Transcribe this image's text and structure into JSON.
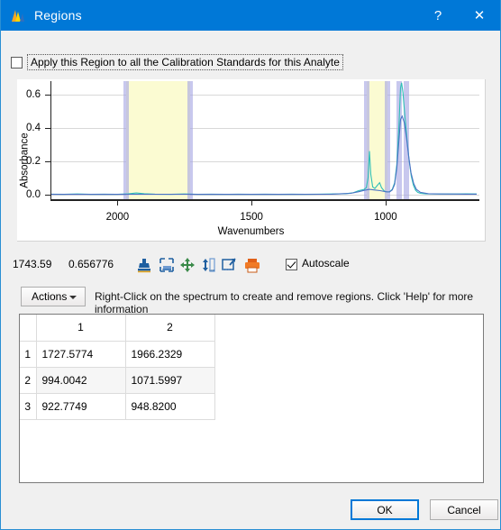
{
  "window": {
    "title": "Regions",
    "icon": "spectrum-peak-icon",
    "help_label": "?",
    "close_label": "✕",
    "accent_color": "#0078d7"
  },
  "apply_region": {
    "label": "Apply this Region to all the Calibration Standards for this Analyte",
    "checked": false
  },
  "chart_data": {
    "type": "line",
    "title": "",
    "xlabel": "Wavenumbers",
    "ylabel": "Absorbance",
    "xlim": [
      2250,
      650
    ],
    "ylim": [
      -0.04,
      0.68
    ],
    "x_ticks": [
      2000,
      1500,
      1000
    ],
    "y_ticks": [
      "0.0",
      "0.2",
      "0.4",
      "0.6"
    ],
    "grid": true,
    "legend": "none",
    "series": [
      {
        "name": "spectrum-teal",
        "color": "#2fbfb8",
        "points": [
          [
            2250,
            0.001
          ],
          [
            2200,
            0.0
          ],
          [
            2150,
            0.002
          ],
          [
            2100,
            0.0
          ],
          [
            2050,
            0.001
          ],
          [
            2000,
            0.0
          ],
          [
            1960,
            0.003
          ],
          [
            1930,
            0.008
          ],
          [
            1900,
            0.004
          ],
          [
            1860,
            0.001
          ],
          [
            1800,
            0.0
          ],
          [
            1750,
            0.002
          ],
          [
            1700,
            0.0
          ],
          [
            1650,
            0.001
          ],
          [
            1600,
            0.0
          ],
          [
            1550,
            0.001
          ],
          [
            1500,
            0.0
          ],
          [
            1450,
            0.001
          ],
          [
            1400,
            0.0
          ],
          [
            1350,
            0.001
          ],
          [
            1300,
            0.0
          ],
          [
            1250,
            0.001
          ],
          [
            1200,
            0.002
          ],
          [
            1150,
            0.004
          ],
          [
            1120,
            0.01
          ],
          [
            1100,
            0.022
          ],
          [
            1080,
            0.03
          ],
          [
            1072,
            0.04
          ],
          [
            1065,
            0.1
          ],
          [
            1060,
            0.26
          ],
          [
            1055,
            0.12
          ],
          [
            1048,
            0.045
          ],
          [
            1040,
            0.035
          ],
          [
            1030,
            0.055
          ],
          [
            1022,
            0.07
          ],
          [
            1015,
            0.04
          ],
          [
            1005,
            0.02
          ],
          [
            995,
            0.014
          ],
          [
            985,
            0.016
          ],
          [
            975,
            0.03
          ],
          [
            966,
            0.07
          ],
          [
            958,
            0.18
          ],
          [
            950,
            0.42
          ],
          [
            944,
            0.64
          ],
          [
            940,
            0.67
          ],
          [
            935,
            0.61
          ],
          [
            928,
            0.47
          ],
          [
            920,
            0.33
          ],
          [
            912,
            0.2
          ],
          [
            904,
            0.11
          ],
          [
            896,
            0.055
          ],
          [
            888,
            0.025
          ],
          [
            880,
            0.012
          ],
          [
            870,
            0.006
          ],
          [
            850,
            0.003
          ],
          [
            800,
            0.002
          ],
          [
            750,
            0.002
          ],
          [
            700,
            0.003
          ],
          [
            660,
            0.002
          ]
        ]
      },
      {
        "name": "spectrum-blue",
        "color": "#4a72c4",
        "points": [
          [
            2250,
            0.0
          ],
          [
            2000,
            0.0
          ],
          [
            1700,
            0.0
          ],
          [
            1400,
            0.0
          ],
          [
            1200,
            0.001
          ],
          [
            1130,
            0.006
          ],
          [
            1100,
            0.016
          ],
          [
            1080,
            0.024
          ],
          [
            1060,
            0.03
          ],
          [
            1040,
            0.026
          ],
          [
            1020,
            0.022
          ],
          [
            1000,
            0.016
          ],
          [
            985,
            0.014
          ],
          [
            975,
            0.026
          ],
          [
            966,
            0.06
          ],
          [
            958,
            0.16
          ],
          [
            950,
            0.33
          ],
          [
            944,
            0.45
          ],
          [
            938,
            0.47
          ],
          [
            930,
            0.43
          ],
          [
            922,
            0.34
          ],
          [
            914,
            0.23
          ],
          [
            905,
            0.13
          ],
          [
            895,
            0.065
          ],
          [
            885,
            0.03
          ],
          [
            870,
            0.012
          ],
          [
            840,
            0.004
          ],
          [
            800,
            0.002
          ],
          [
            700,
            0.001
          ],
          [
            660,
            0.001
          ]
        ]
      }
    ],
    "regions": [
      {
        "index": 1,
        "start": 1727.5774,
        "end": 1966.2329,
        "fill": "#fbfbd2",
        "edge": "#a6a6e3",
        "selected": true
      },
      {
        "index": 2,
        "start": 994.0042,
        "end": 1071.5997,
        "fill": "#fbfbd2",
        "edge": "#a6a6e3",
        "selected": true
      },
      {
        "index": 3,
        "start": 922.7749,
        "end": 948.82,
        "fill": "#ffffff",
        "edge": "#a6a6e3",
        "selected": false
      }
    ]
  },
  "toolbar": {
    "cursor_x": "1743.59",
    "cursor_y": "0.656776",
    "icons": [
      {
        "name": "stamp-tool-icon",
        "title": "Stamp"
      },
      {
        "name": "zoom-box-icon",
        "title": "Zoom box"
      },
      {
        "name": "pan-move-icon",
        "title": "Pan"
      },
      {
        "name": "y-scale-icon",
        "title": "Scale Y"
      },
      {
        "name": "annotate-box-icon",
        "title": "Annotate"
      },
      {
        "name": "print-icon",
        "title": "Print"
      }
    ],
    "autoscale": {
      "label": "Autoscale",
      "checked": true
    }
  },
  "actions": {
    "button_label": "Actions",
    "caret": "chevron-down-icon",
    "hint": "Right-Click on the spectrum to create and remove regions. Click 'Help' for more information"
  },
  "table": {
    "columns": [
      "1",
      "2"
    ],
    "rows": [
      {
        "num": "1",
        "values": [
          "1727.5774",
          "1966.2329"
        ]
      },
      {
        "num": "2",
        "values": [
          "994.0042",
          "1071.5997"
        ]
      },
      {
        "num": "3",
        "values": [
          "922.7749",
          "948.8200"
        ]
      }
    ]
  },
  "footer": {
    "ok_label": "OK",
    "cancel_label": "Cancel"
  }
}
